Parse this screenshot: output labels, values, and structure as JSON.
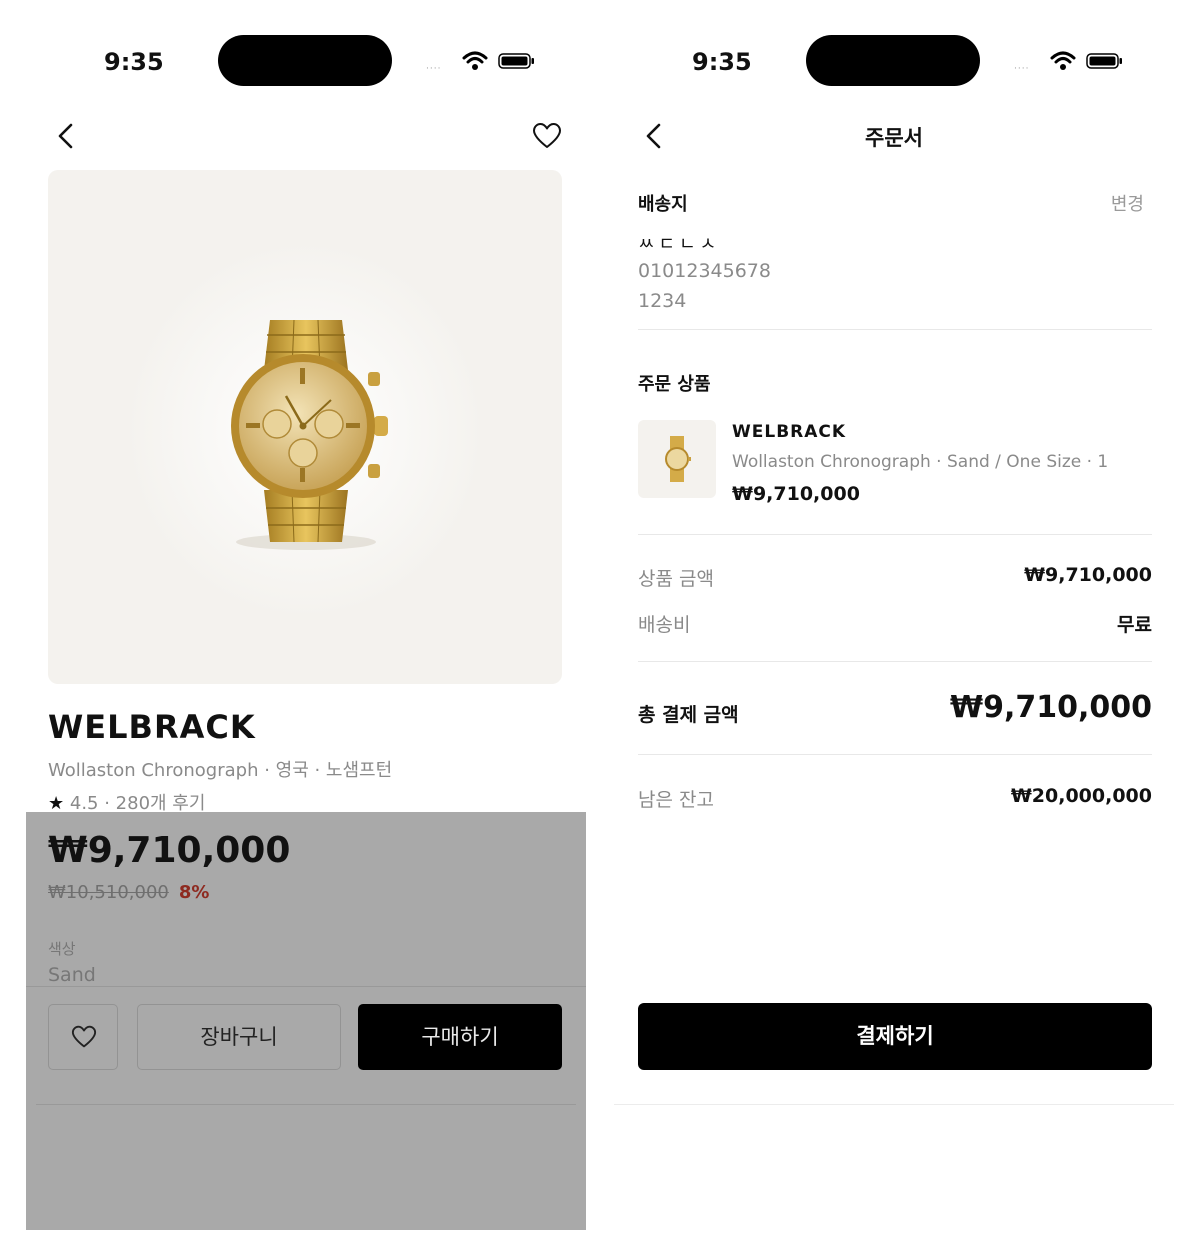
{
  "status_bar": {
    "time": "9:35",
    "signal_dots": "····"
  },
  "product_screen": {
    "brand": "WELBRACK",
    "subtitle": "Wollaston Chronograph · 영국 · 노샘프턴",
    "rating_star": "★",
    "rating_text": "4.5 · 280개 후기",
    "price": "₩9,710,000",
    "original_price": "₩10,510,000",
    "discount": "8%",
    "option_label": "색상",
    "option_value": "Sand",
    "cart_button": "장바구니",
    "buy_button": "구매하기",
    "icons": {
      "back": "chevron-left-icon",
      "wishlist": "heart-icon",
      "product": "gold-watch-image"
    }
  },
  "order_screen": {
    "title": "주문서",
    "shipping": {
      "section_title": "배송지",
      "change_label": "변경",
      "name": "ㅆㄷㄴㅅ",
      "phone": "01012345678",
      "address": "1234"
    },
    "items": {
      "section_title": "주문 상품",
      "brand": "WELBRACK",
      "description": "Wollaston Chronograph · Sand / One Size · 1",
      "price": "₩9,710,000"
    },
    "summary": {
      "product_amount_label": "상품 금액",
      "product_amount_value": "₩9,710,000",
      "shipping_fee_label": "배송비",
      "shipping_fee_value": "무료",
      "total_label": "총 결제 금액",
      "total_value": "₩9,710,000",
      "balance_label": "남은 잔고",
      "balance_value": "₩20,000,000"
    },
    "pay_button": "결제하기"
  },
  "colors": {
    "black": "#000000",
    "discount": "#8e2a20",
    "muted_text": "#8a8a8a",
    "overlay": "#a9a9a9",
    "image_bg": "#f4f2ee"
  }
}
